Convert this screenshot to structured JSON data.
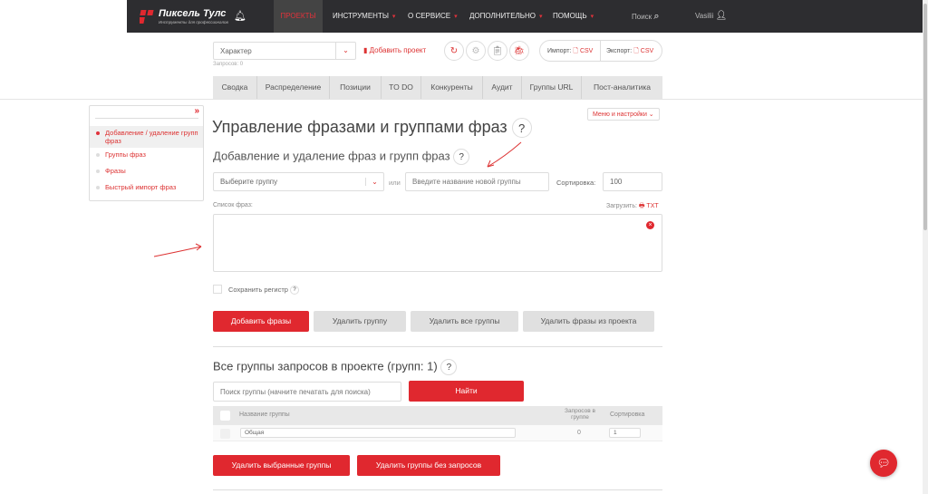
{
  "header": {
    "logo": "Пиксель Тулс",
    "logo_sub": "Инструменты для профессионалов",
    "nav": [
      {
        "label": "ПРОЕКТЫ",
        "active": true
      },
      {
        "label": "ИНСТРУМЕНТЫ",
        "caret": true
      },
      {
        "label": "О СЕРВИСЕ",
        "caret": true
      },
      {
        "label": "ДОПОЛНИТЕЛЬНО",
        "caret": true
      },
      {
        "label": "ПОМОЩЬ",
        "caret": true
      }
    ],
    "search": "Поиск",
    "user": "Vasilii"
  },
  "project": {
    "selected": "Характер",
    "requests": "Запросов: 0",
    "add_project": "Добавить проект",
    "import_label": "Импорт:",
    "export_label": "Экспорт:",
    "csv": "CSV"
  },
  "tabs": [
    "Сводка",
    "Распределение",
    "Позиции",
    "TO DO",
    "Конкуренты",
    "Аудит",
    "Группы URL",
    "Пост-аналитика"
  ],
  "sidebar": {
    "items": [
      "Добавление / удаление групп фраз",
      "Группы фраз",
      "Фразы",
      "Быстрый импорт фраз"
    ]
  },
  "menu_settings": "Меню и настройки",
  "main": {
    "title": "Управление фразами и группами фраз",
    "subtitle": "Добавление и удаление фраз и групп фраз",
    "group_select": "Выберите группу",
    "or": "или",
    "new_group_placeholder": "Введите название новой группы",
    "sort_label": "Сортировка:",
    "sort_value": "100",
    "phrases_label": "Список фраз:",
    "upload_label": "Загрузить:",
    "txt": "TXT",
    "case_label": "Сохранить регистр",
    "buttons": {
      "add": "Добавить фразы",
      "del_group": "Удалить группу",
      "del_all": "Удалить все группы",
      "del_phrases": "Удалить фразы из проекта"
    }
  },
  "groups": {
    "title": "Все группы запросов в проекте (групп: 1)",
    "search_placeholder": "Поиск группы (начните печатать для поиска)",
    "find": "Найти",
    "columns": {
      "name": "Название группы",
      "count": "Запросов в группе",
      "sort": "Сортировка"
    },
    "rows": [
      {
        "name": "Общая",
        "count": "0",
        "sort": "1"
      }
    ],
    "del_selected": "Удалить выбранные группы",
    "del_empty": "Удалить группы без запросов"
  },
  "colors": {
    "accent": "#e0282f",
    "nav_bg": "#2d2d30"
  }
}
